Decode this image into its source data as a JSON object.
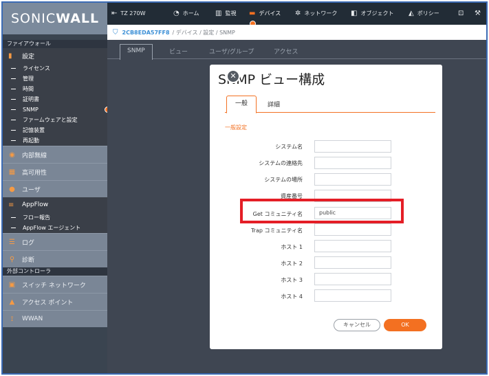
{
  "brand": {
    "prefix": "SONIC",
    "suffix": "WALL"
  },
  "sidebar": {
    "section_firewall": "ファイアウォール",
    "settings_title": "設定",
    "settings_items": [
      "ライセンス",
      "管理",
      "時間",
      "証明書",
      "SNMP",
      "ファームウェアと設定",
      "記憶装置",
      "再起動"
    ],
    "nav_wireless": "内部無線",
    "nav_ha": "高可用性",
    "nav_users": "ユーザ",
    "appflow_title": "AppFlow",
    "appflow_items": [
      "フロー報告",
      "AppFlow エージェント"
    ],
    "nav_log": "ログ",
    "nav_diag": "診断",
    "section_ext": "外部コントローラ",
    "nav_switch": "スイッチ ネットワーク",
    "nav_ap": "アクセス ポイント",
    "nav_wwan": "WWAN"
  },
  "topbar": {
    "device": "TZ 270W",
    "home": "ホーム",
    "monitor": "監視",
    "devices": "デバイス",
    "network": "ネットワーク",
    "object": "オブジェクト",
    "policy": "ポリシー"
  },
  "breadcrumb": {
    "serial": "2CB8EDA57FF8",
    "path": "/ デバイス / 設定 / SNMP"
  },
  "tabs": [
    "SNMP",
    "ビュー",
    "ユーザ/グループ",
    "アクセス"
  ],
  "modal": {
    "title": "SNMP ビュー構成",
    "tabs": [
      "一般",
      "詳細"
    ],
    "section": "一般設定",
    "fields": [
      {
        "label": "システム名",
        "value": ""
      },
      {
        "label": "システムの連絡先",
        "value": ""
      },
      {
        "label": "システムの場所",
        "value": ""
      },
      {
        "label": "資産番号",
        "value": ""
      },
      {
        "label": "Get コミュニティ名",
        "value": "public"
      },
      {
        "label": "Trap コミュニティ名",
        "value": ""
      },
      {
        "label": "ホスト 1",
        "value": ""
      },
      {
        "label": "ホスト 2",
        "value": ""
      },
      {
        "label": "ホスト 3",
        "value": ""
      },
      {
        "label": "ホスト 4",
        "value": ""
      }
    ],
    "cancel": "キャンセル",
    "ok": "OK"
  },
  "colors": {
    "accent": "#f37021",
    "highlight": "#e41e26",
    "link": "#3b8fd6"
  }
}
